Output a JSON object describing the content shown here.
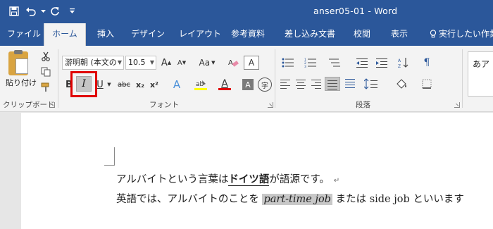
{
  "window": {
    "title": "anser05-01 - Word"
  },
  "qat": {
    "save_icon": "save-icon",
    "undo_icon": "undo-icon",
    "redo_icon": "repeat-icon",
    "customize_icon": "customize-qat-icon"
  },
  "tabs": [
    {
      "label": "ファイル"
    },
    {
      "label": "ホーム",
      "active": true
    },
    {
      "label": "挿入"
    },
    {
      "label": "デザイン"
    },
    {
      "label": "レイアウト"
    },
    {
      "label": "参考資料"
    },
    {
      "label": "差し込み文書"
    },
    {
      "label": "校閲"
    },
    {
      "label": "表示"
    },
    {
      "label": "実行したい作業"
    }
  ],
  "ribbon": {
    "clipboard": {
      "label": "クリップボード",
      "paste_label": "貼り付け"
    },
    "font": {
      "label": "フォント",
      "font_name": "游明朝 (本文の",
      "font_size": "10.5",
      "bold": "B",
      "italic": "I",
      "underline": "U",
      "strike": "abc",
      "subscript": "x₂",
      "superscript": "x²",
      "change_case": "Aa",
      "grow": "A",
      "shrink": "A",
      "enclose": "字"
    },
    "paragraph": {
      "label": "段落"
    },
    "styles": {
      "preview": "あア"
    }
  },
  "document": {
    "line1": {
      "before": "アルバイトという言葉は",
      "bold": "ドイツ語",
      "after": "が語源です。",
      "mark": "↵"
    },
    "line2": {
      "before": "英語では、アルバイトのことを ",
      "italic": "part-time job",
      "middle": " または ",
      "plain": "side job",
      "after": " といいます"
    }
  },
  "colors": {
    "titlebar": "#2b579a",
    "highlight_border": "#e00000",
    "font_color_bar": "#e00000",
    "highlight_color_bar": "#ffff00"
  }
}
